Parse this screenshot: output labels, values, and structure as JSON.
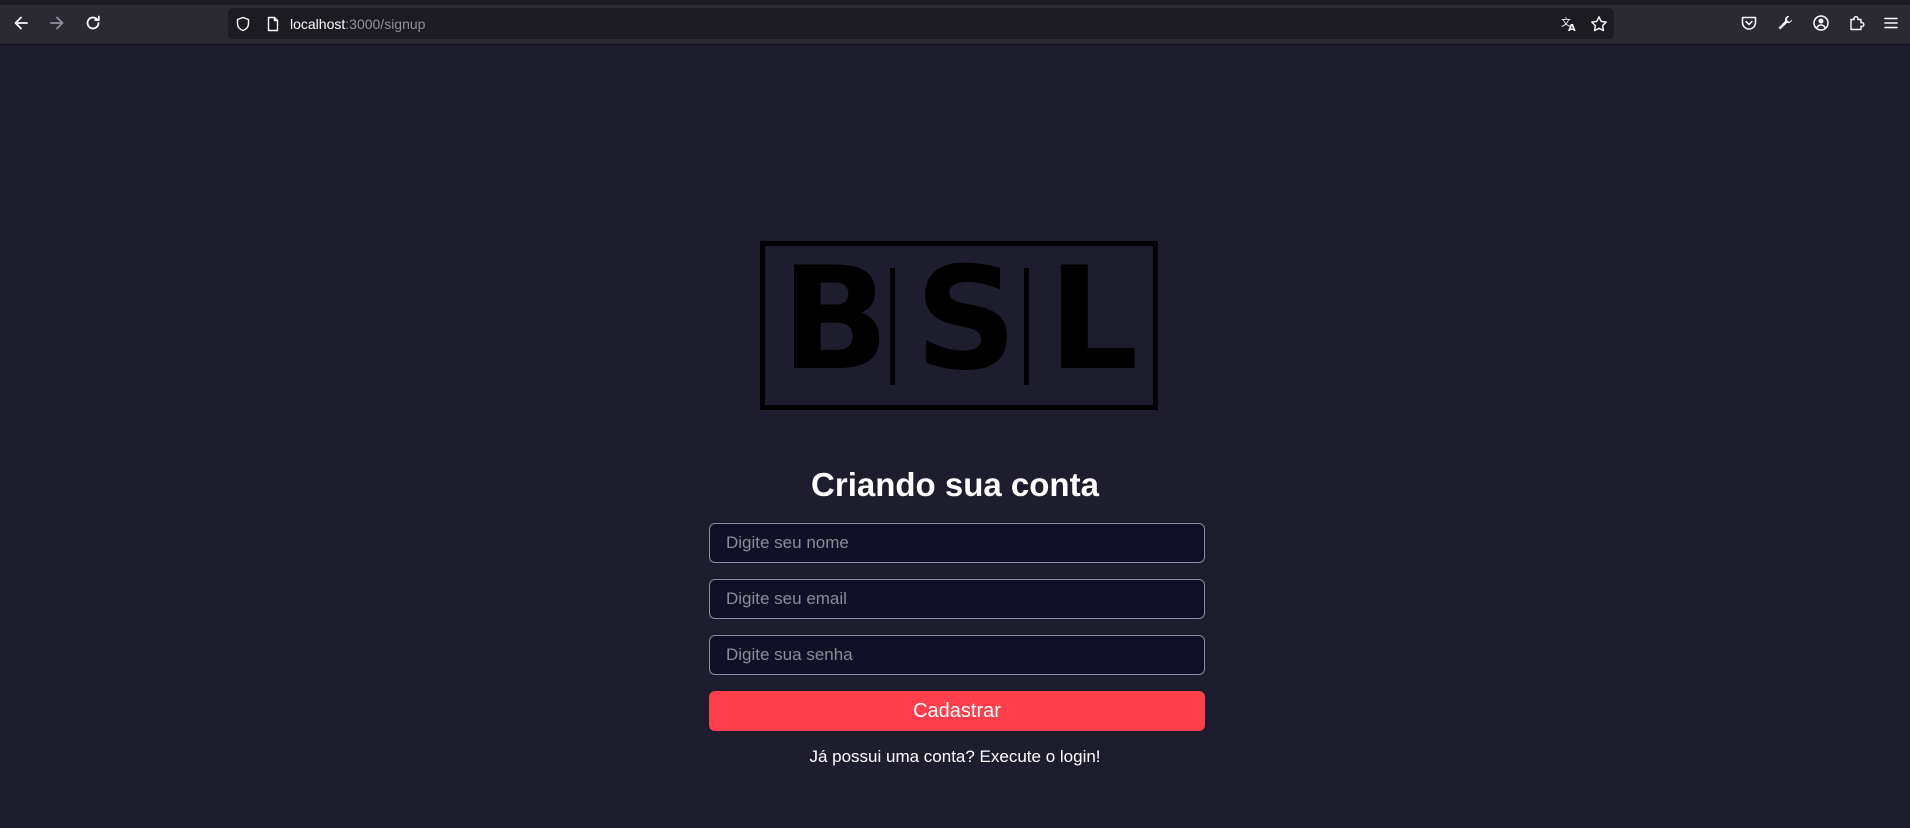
{
  "browser": {
    "url_host": "localhost",
    "url_path": ":3000/signup",
    "icons": {
      "back": "back-arrow-icon",
      "forward": "forward-arrow-icon",
      "reload": "reload-icon",
      "shield": "shield-icon",
      "page": "page-icon",
      "translate": "translate-icon",
      "bookmark": "star-icon",
      "pocket": "pocket-icon",
      "tools": "wrench-icon",
      "account": "account-icon",
      "extensions": "puzzle-icon",
      "menu": "hamburger-menu-icon"
    }
  },
  "logo": {
    "letters": [
      "B",
      "S",
      "L"
    ]
  },
  "form": {
    "title": "Criando sua conta",
    "name_placeholder": "Digite seu nome",
    "email_placeholder": "Digite seu email",
    "password_placeholder": "Digite sua senha",
    "submit_label": "Cadastrar",
    "login_link": "Já possui uma conta? Execute o login!"
  },
  "colors": {
    "background": "#1d1d2e",
    "input_background": "#101026",
    "accent": "#ff3f4b",
    "text": "#ffffff"
  }
}
